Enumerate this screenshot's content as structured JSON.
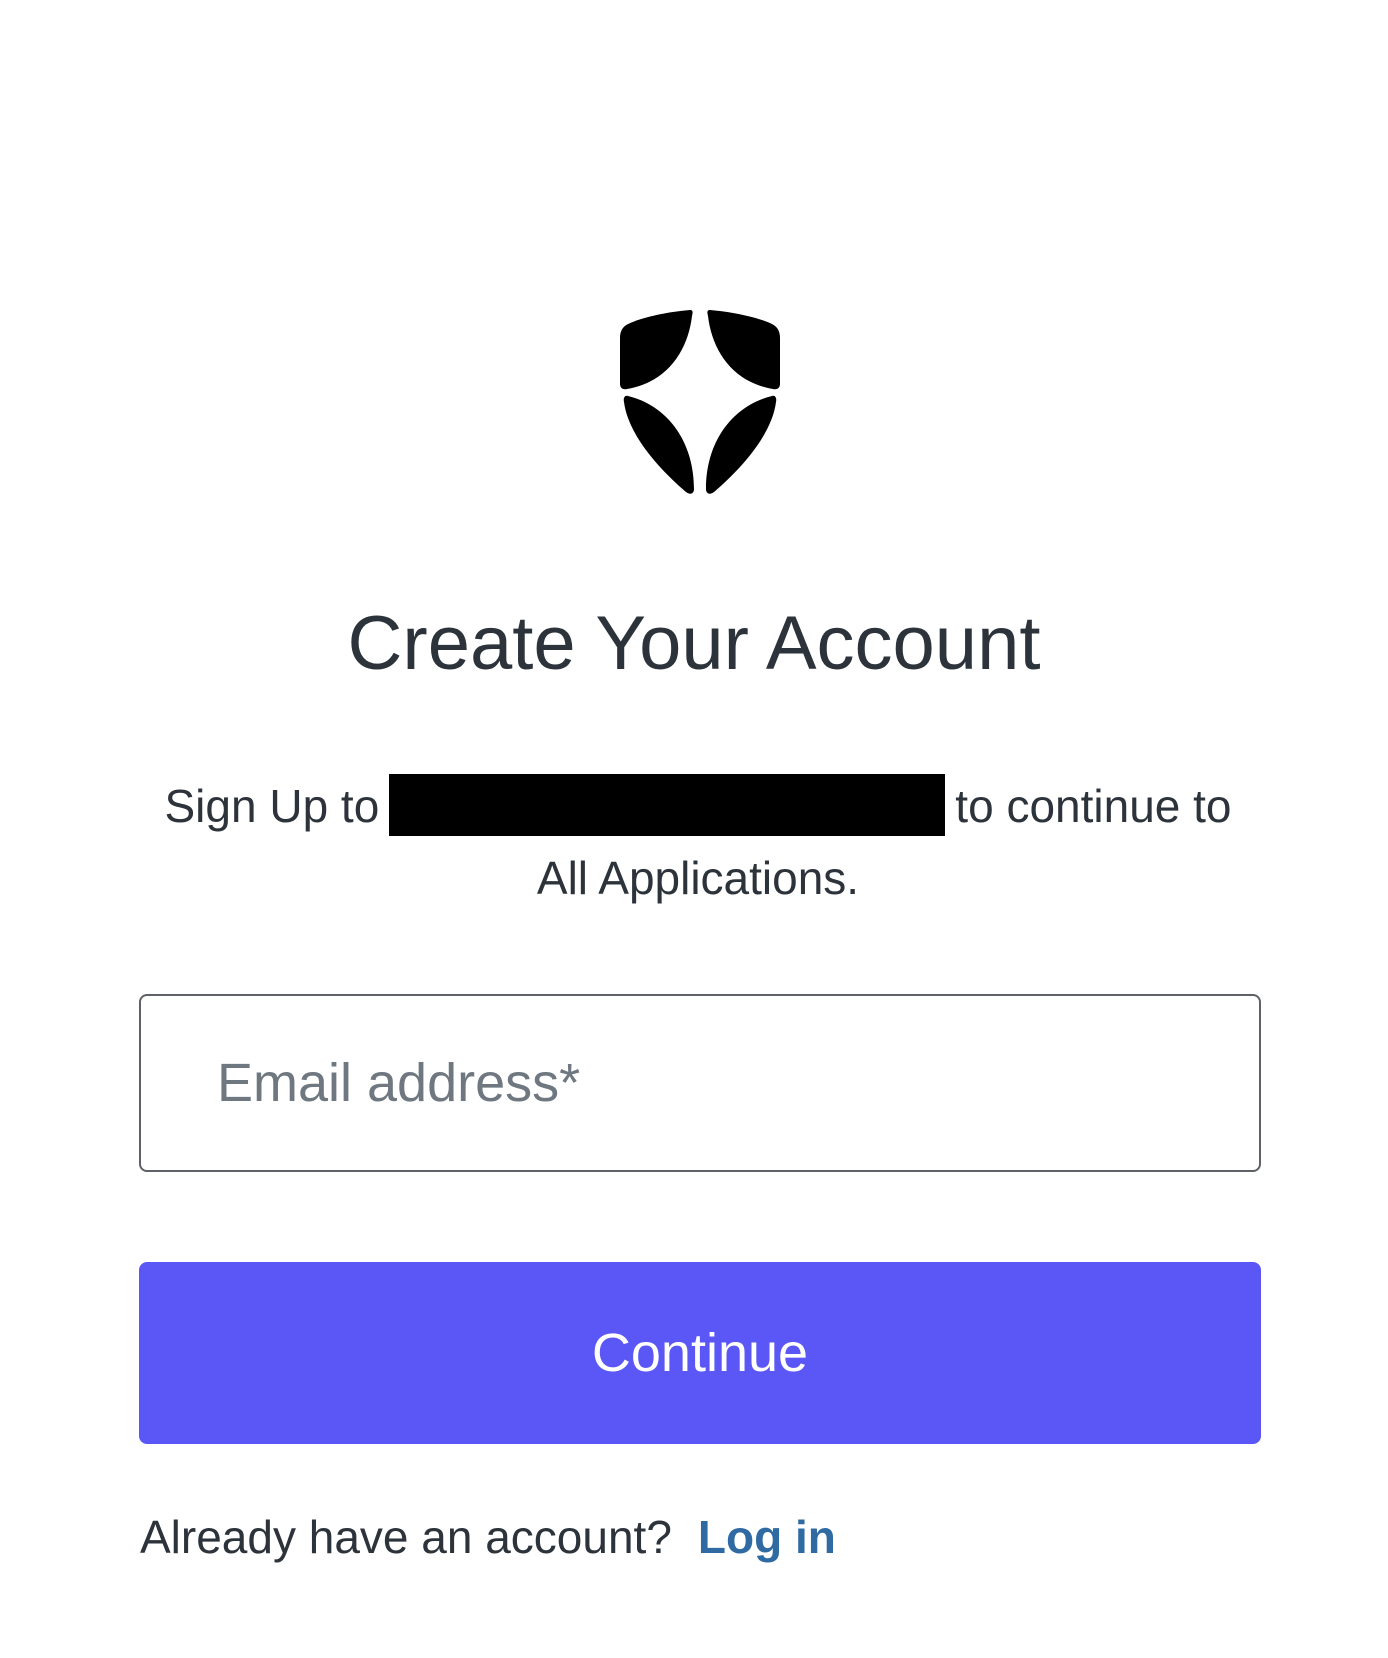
{
  "logo": {
    "icon": "shield-star-icon",
    "color": "#000000"
  },
  "header": {
    "title": "Create Your Account"
  },
  "subtitle": {
    "prefix": "Sign Up to",
    "suffix": "to continue to",
    "line2": "All Applications."
  },
  "form": {
    "email_label": "Email address*",
    "continue_label": "Continue"
  },
  "footer": {
    "prompt": "Already have an account?",
    "login_label": "Log in"
  },
  "colors": {
    "primary": "#5a57f6",
    "link": "#2f6aa3",
    "text": "#2d333a",
    "placeholder": "#6f7780"
  }
}
